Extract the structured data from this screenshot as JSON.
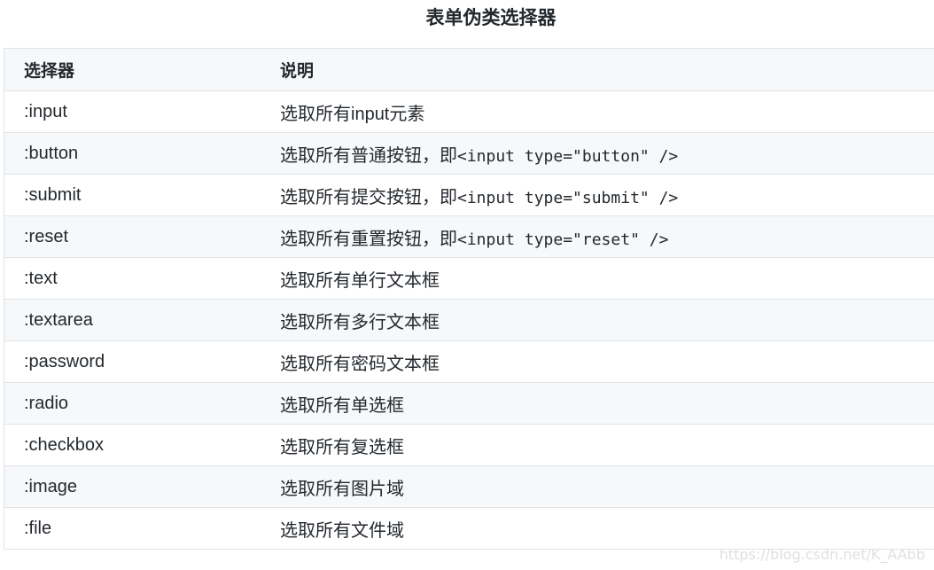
{
  "title": "表单伪类选择器",
  "table": {
    "headers": [
      "选择器",
      "说明"
    ],
    "rows": [
      {
        "selector": ":input",
        "desc": "选取所有input元素",
        "code": ""
      },
      {
        "selector": ":button",
        "desc": "选取所有普通按钮，即",
        "code": "<input type=\"button\" />"
      },
      {
        "selector": ":submit",
        "desc": "选取所有提交按钮，即",
        "code": "<input type=\"submit\" />"
      },
      {
        "selector": ":reset",
        "desc": "选取所有重置按钮，即",
        "code": "<input type=\"reset\" />"
      },
      {
        "selector": ":text",
        "desc": "选取所有单行文本框",
        "code": ""
      },
      {
        "selector": ":textarea",
        "desc": "选取所有多行文本框",
        "code": ""
      },
      {
        "selector": ":password",
        "desc": "选取所有密码文本框",
        "code": ""
      },
      {
        "selector": ":radio",
        "desc": "选取所有单选框",
        "code": ""
      },
      {
        "selector": ":checkbox",
        "desc": "选取所有复选框",
        "code": ""
      },
      {
        "selector": ":image",
        "desc": "选取所有图片域",
        "code": ""
      },
      {
        "selector": ":file",
        "desc": "选取所有文件域",
        "code": ""
      }
    ]
  },
  "watermark": "https://blog.csdn.net/K_AAbb"
}
